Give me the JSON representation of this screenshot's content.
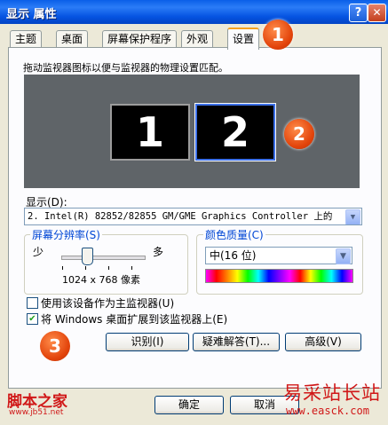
{
  "window": {
    "title": "显示 属性",
    "help_glyph": "?",
    "close_glyph": "✕"
  },
  "tabs": [
    {
      "label": "主题"
    },
    {
      "label": "桌面"
    },
    {
      "label": "屏幕保护程序"
    },
    {
      "label": "外观"
    },
    {
      "label": "设置"
    }
  ],
  "settings": {
    "instruction": "拖动监视器图标以便与监视器的物理设置匹配。",
    "monitors": [
      "1",
      "2"
    ],
    "display_label": "显示(D):",
    "display_value": "2. Intel(R) 82852/82855 GM/GME Graphics Controller 上的",
    "resolution": {
      "title": "屏幕分辨率(S)",
      "less": "少",
      "more": "多",
      "value_text": "1024 x 768 像素",
      "slider_fraction": 0.3
    },
    "color_quality": {
      "title": "颜色质量(C)",
      "value": "中(16 位)"
    },
    "checkbox_primary": {
      "label": "使用该设备作为主监视器(U)",
      "checked": false
    },
    "checkbox_extend": {
      "label": "将 Windows 桌面扩展到该监视器上(E)",
      "checked": true
    },
    "buttons": {
      "identify": "识别(I)",
      "troubleshoot": "疑难解答(T)...",
      "advanced": "高级(V)"
    }
  },
  "dialog_buttons": {
    "ok": "确定",
    "cancel": "取消"
  },
  "callouts": [
    "1",
    "2",
    "3"
  ],
  "watermarks": {
    "left": "脚本之家",
    "left_url": "www.jb51.net",
    "right": "易采站长站",
    "right_url": "www.easck.com"
  },
  "colors": {
    "title_bar": "#0A5FE8",
    "callout": "#E2430A",
    "active_tab_accent": "#F6A21E",
    "group_title": "#0046D5"
  }
}
